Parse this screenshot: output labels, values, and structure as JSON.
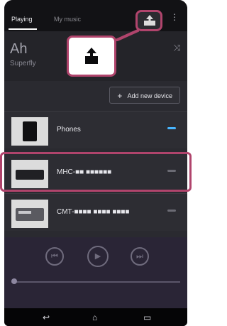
{
  "tabs": {
    "playing": "Playing",
    "my_music": "My music"
  },
  "hero": {
    "artist": "Ah",
    "subtitle": "Superfly"
  },
  "actions": {
    "add_device_label": "Add new device"
  },
  "devices": [
    {
      "name": "Phones",
      "state": "on"
    },
    {
      "name": "MHC-■■ ■■■■■■",
      "state": "off"
    },
    {
      "name": "CMT-■■■■ ■■■■ ■■■■",
      "state": "off"
    }
  ],
  "icons": {
    "device_select": "upload-icon",
    "menu": "overflow-menu-icon",
    "shuffle": "shuffle-icon",
    "back": "back-icon",
    "home": "home-icon",
    "recents": "recents-icon"
  },
  "colors": {
    "highlight": "#b0446c",
    "active_device": "#48b5ff"
  }
}
